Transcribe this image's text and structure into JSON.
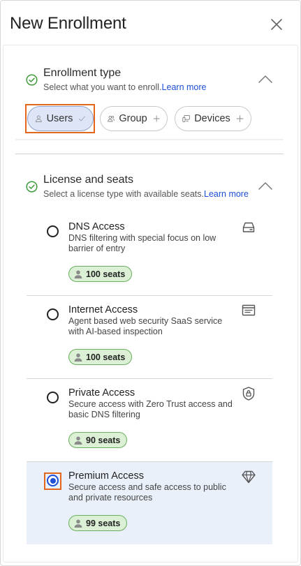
{
  "panel": {
    "title": "New Enrollment",
    "close_icon": "close-icon"
  },
  "enrollment_type": {
    "title": "Enrollment type",
    "subtitle": "Select what you want to enroll.",
    "learn_more": "Learn more",
    "status_icon": "check-circle-icon",
    "toggle_icon": "chevron-up-icon",
    "options": [
      {
        "label": "Users",
        "icon": "user-icon",
        "selected": true,
        "trail_icon": "check-icon"
      },
      {
        "label": "Group",
        "icon": "group-icon",
        "selected": false,
        "trail_icon": "plus-icon"
      },
      {
        "label": "Devices",
        "icon": "devices-icon",
        "selected": false,
        "trail_icon": "plus-icon"
      }
    ]
  },
  "license": {
    "title": "License and seats",
    "subtitle": "Select a license type with available seats.",
    "learn_more": "Learn more",
    "status_icon": "check-circle-icon",
    "toggle_icon": "chevron-up-icon",
    "items": [
      {
        "name": "DNS Access",
        "desc": "DNS filtering with special focus on low barrier of entry",
        "seats": "100 seats",
        "icon": "drive-icon",
        "selected": false
      },
      {
        "name": "Internet Access",
        "desc": "Agent based web security SaaS service with AI-based inspection",
        "seats": "100 seats",
        "icon": "browser-window-icon",
        "selected": false
      },
      {
        "name": "Private Access",
        "desc": "Secure access with Zero Trust access and basic DNS filtering",
        "seats": "90 seats",
        "icon": "shield-lock-icon",
        "selected": false
      },
      {
        "name": "Premium Access",
        "desc": "Secure access and safe access to public and private resources",
        "seats": "99 seats",
        "icon": "diamond-icon",
        "selected": true
      }
    ]
  },
  "colors": {
    "accent": "#1f4fd6",
    "highlight": "#e4661b",
    "success": "#3e9b3a",
    "seats_bg": "#dcf0d6"
  }
}
